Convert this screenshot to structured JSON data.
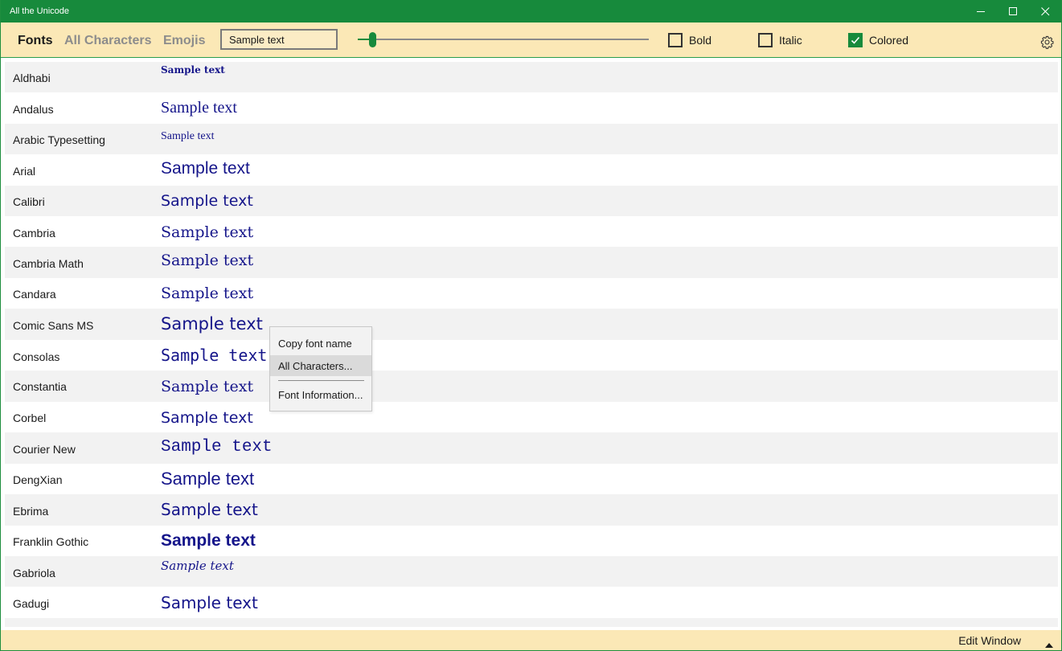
{
  "window": {
    "title": "All the Unicode",
    "minimize_icon": "minimize-icon",
    "maximize_icon": "maximize-icon",
    "close_icon": "close-icon",
    "accent": "#178a3c"
  },
  "toolbar": {
    "tabs": [
      "Fonts",
      "All Characters",
      "Emojis"
    ],
    "active_tab": "Fonts",
    "sample_text": "Sample text",
    "size_slider_fraction": 0.05,
    "checkboxes": [
      {
        "label": "Bold",
        "checked": false
      },
      {
        "label": "Italic",
        "checked": false
      },
      {
        "label": "Colored",
        "checked": true
      }
    ],
    "settings_icon": "gear-icon",
    "background": "#fbe8b6"
  },
  "fonts": [
    {
      "name": "Aldhabi",
      "sample": "Sample text"
    },
    {
      "name": "Andalus",
      "sample": "Sample text"
    },
    {
      "name": "Arabic Typesetting",
      "sample": "Sample text"
    },
    {
      "name": "Arial",
      "sample": "Sample text"
    },
    {
      "name": "Calibri",
      "sample": "Sample text"
    },
    {
      "name": "Cambria",
      "sample": "Sample text"
    },
    {
      "name": "Cambria Math",
      "sample": "Sample text"
    },
    {
      "name": "Candara",
      "sample": "Sample text"
    },
    {
      "name": "Comic Sans MS",
      "sample": "Sample text"
    },
    {
      "name": "Consolas",
      "sample": "Sample text"
    },
    {
      "name": "Constantia",
      "sample": "Sample text"
    },
    {
      "name": "Corbel",
      "sample": "Sample text"
    },
    {
      "name": "Courier New",
      "sample": "Sample text"
    },
    {
      "name": "DengXian",
      "sample": "Sample text"
    },
    {
      "name": "Ebrima",
      "sample": "Sample text"
    },
    {
      "name": "Franklin Gothic",
      "sample": "Sample text"
    },
    {
      "name": "Gabriola",
      "sample": "Sample text"
    },
    {
      "name": "Gadugi",
      "sample": "Sample text"
    }
  ],
  "sample_color": "#15158a",
  "context_menu": {
    "items": [
      "Copy font name",
      "All Characters...",
      "Font Information..."
    ],
    "highlighted": "All Characters..."
  },
  "statusbar": {
    "edit_label": "Edit Window",
    "caret_icon": "caret-up-icon"
  }
}
